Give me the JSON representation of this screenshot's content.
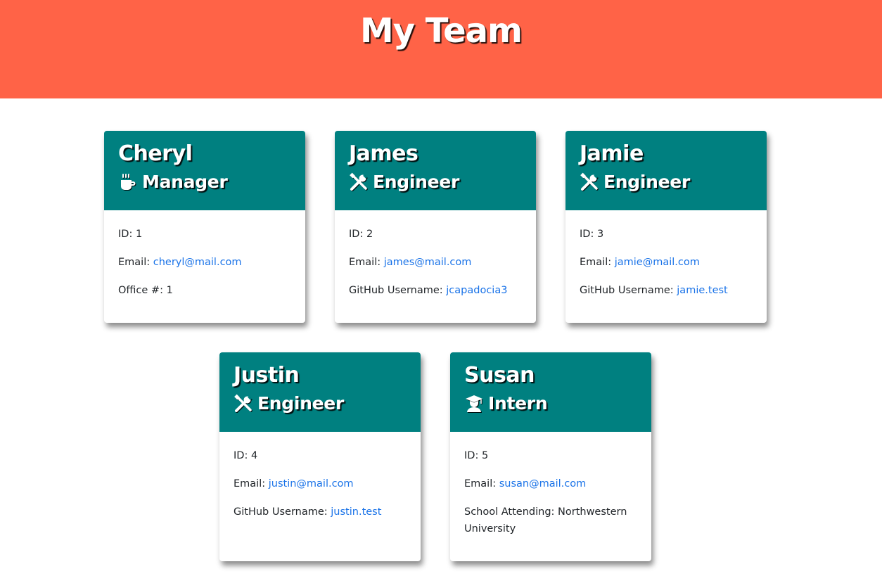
{
  "page": {
    "title": "My Team"
  },
  "employees": [
    {
      "name": "Cheryl",
      "role": "Manager",
      "icon": "coffee-icon",
      "id_label": "ID: ",
      "id": "1",
      "email_label": "Email: ",
      "email": "cheryl@mail.com",
      "extra_label": "Office #: ",
      "extra": "1"
    },
    {
      "name": "James",
      "role": "Engineer",
      "icon": "tools-icon",
      "id_label": "ID: ",
      "id": "2",
      "email_label": "Email: ",
      "email": "james@mail.com",
      "extra_label": "GitHub Username: ",
      "extra": "jcapadocia3"
    },
    {
      "name": "Jamie",
      "role": "Engineer",
      "icon": "tools-icon",
      "id_label": "ID: ",
      "id": "3",
      "email_label": "Email: ",
      "email": "jamie@mail.com",
      "extra_label": "GitHub Username: ",
      "extra": "jamie.test"
    },
    {
      "name": "Justin",
      "role": "Engineer",
      "icon": "tools-icon",
      "id_label": "ID: ",
      "id": "4",
      "email_label": "Email: ",
      "email": "justin@mail.com",
      "extra_label": "GitHub Username: ",
      "extra": "justin.test"
    },
    {
      "name": "Susan",
      "role": "Intern",
      "icon": "graduate-icon",
      "id_label": "ID: ",
      "id": "5",
      "email_label": "Email: ",
      "email": "susan@mail.com",
      "extra_label": "School Attending: ",
      "extra": "Northwestern University"
    }
  ],
  "colors": {
    "header_bg": "#ff6347",
    "card_header_bg": "#008080",
    "link": "#1a73e8"
  }
}
